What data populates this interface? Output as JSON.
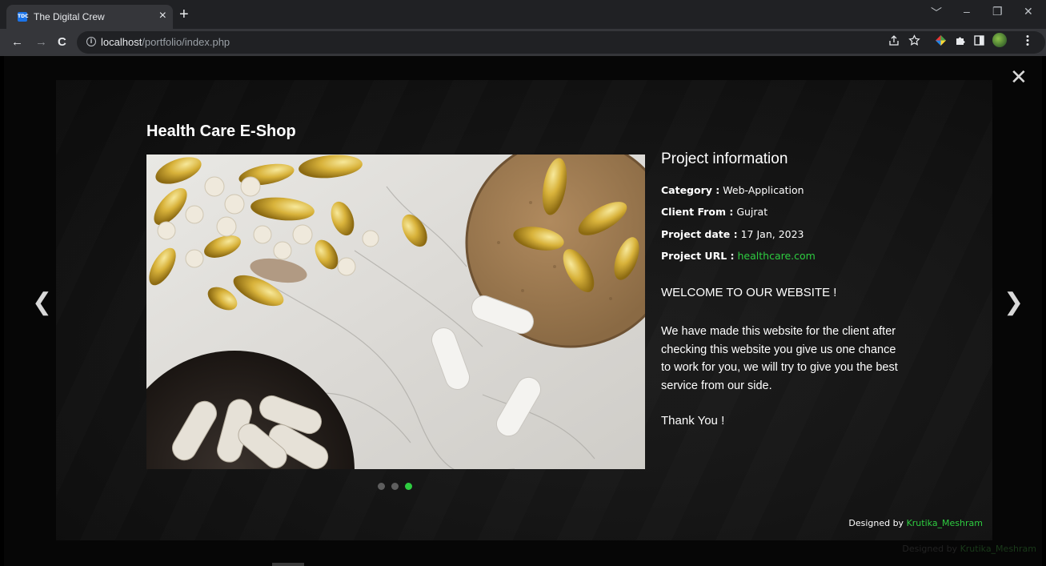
{
  "browser": {
    "tab": {
      "favicon_text": "TDC",
      "title": "The Digital Crew",
      "close": "×"
    },
    "new_tab": "+",
    "window_controls": {
      "dropdown": "﹀",
      "minimize": "–",
      "restore": "❐",
      "close": "✕"
    },
    "nav": {
      "back": "←",
      "forward": "→",
      "reload": "C"
    },
    "address": {
      "host": "localhost",
      "path": "/portfolio/index.php"
    },
    "toolbar_icons": [
      "share-icon",
      "star-icon",
      "extension-color-icon",
      "puzzle-icon",
      "sidepanel-icon",
      "profile-avatar",
      "menu-icon"
    ]
  },
  "lightbox": {
    "close": "✕",
    "prev": "❮",
    "next": "❯",
    "title": "Health Care E-Shop",
    "slider": {
      "total": 3,
      "active": 3
    },
    "info": {
      "heading": "Project information",
      "category_label": "Category :",
      "category_value": "Web-Application",
      "client_label": "Client From :",
      "client_value": "Gujrat",
      "date_label": "Project date :",
      "date_value": "17 Jan, 2023",
      "url_label": "Project URL :",
      "url_value": "healthcare.com",
      "welcome": "WELCOME TO OUR WEBSITE !",
      "description": "We have made this website for the client after checking this website you give us one chance to work for you, we will try to give you the best service from our side.",
      "thanks": "Thank You !"
    },
    "credit": {
      "prefix": "Designed by",
      "name": "Krutika_Meshram"
    }
  },
  "colors": {
    "accent_green": "#2ecc40",
    "chrome_dark": "#202124",
    "chrome_mid": "#35363a"
  }
}
